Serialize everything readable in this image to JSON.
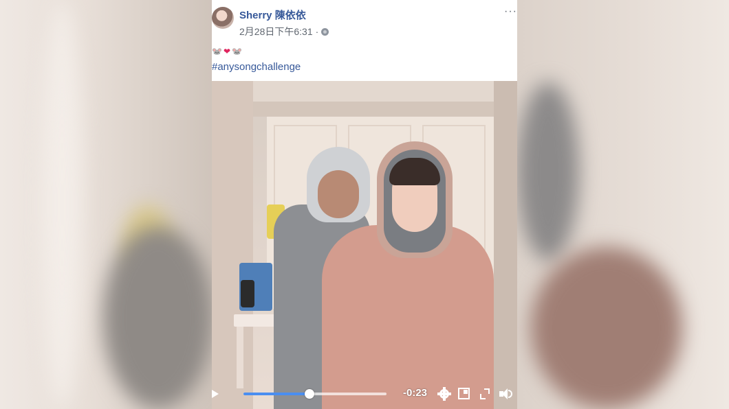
{
  "post": {
    "author": "Sherry 陳依依",
    "timestamp": "2月28日下午6:31",
    "separator": "·",
    "privacy_icon": "globe-icon",
    "more_label": "···",
    "emoji_line": [
      "🐭",
      "❤",
      "🐭"
    ],
    "hashtag": "#anysongchallenge"
  },
  "video": {
    "remaining_time": "-0:23",
    "progress_fraction": 0.46,
    "icons": [
      "play-icon",
      "settings-gear-icon",
      "picture-in-picture-icon",
      "fullscreen-icon",
      "volume-icon"
    ]
  },
  "colors": {
    "link": "#365899",
    "meta": "#606770",
    "progress": "#4a8ef0"
  }
}
